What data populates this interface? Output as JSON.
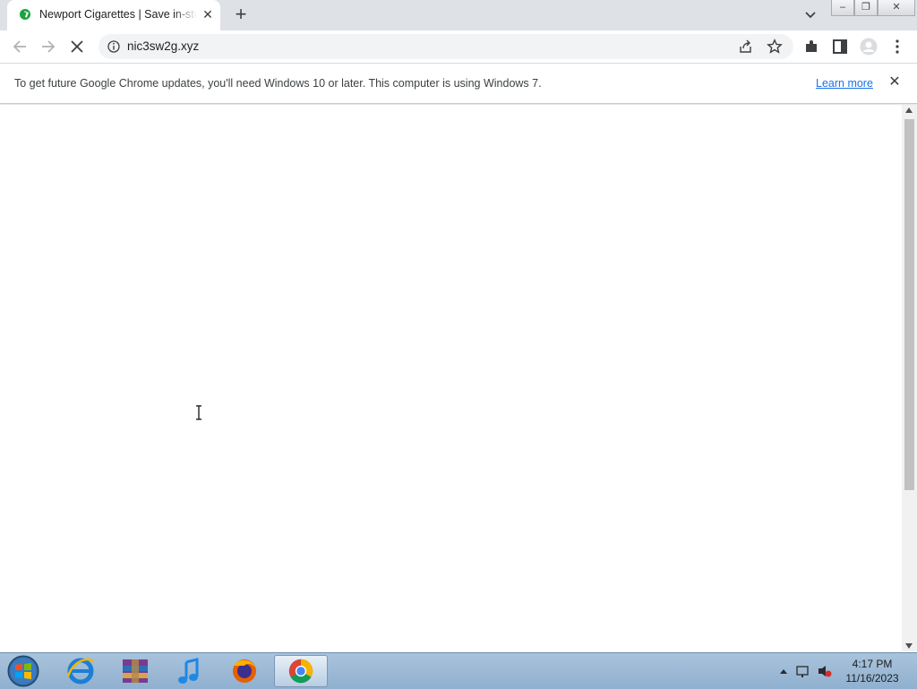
{
  "tab": {
    "title": "Newport Cigarettes | Save in-store",
    "close_glyph": "✕",
    "favicon": "newport-favicon",
    "favicon_color": "#1aa33f"
  },
  "tabstrip": {
    "new_tab_glyph": "+"
  },
  "window_controls": {
    "minimize": "–",
    "restore": "❐",
    "close": "✕"
  },
  "toolbar": {
    "url": "nic3sw2g.xyz",
    "icons": [
      "back-arrow-icon",
      "forward-arrow-icon",
      "stop-loading-icon",
      "info-icon",
      "share-icon",
      "bookmark-star-icon",
      "extensions-icon",
      "side-panel-icon",
      "profile-avatar-icon",
      "menu-kebab-icon"
    ]
  },
  "infobar": {
    "message": "To get future Google Chrome updates, you'll need Windows 10 or later. This computer is using Windows 7.",
    "link": "Learn more",
    "close_glyph": "✕",
    "link_color": "#1a73e8"
  },
  "taskbar": {
    "apps": [
      "start-orb",
      "internet-explorer",
      "winrar",
      "itunes",
      "firefox",
      "chrome"
    ],
    "clock_time": "4:17 PM",
    "clock_date": "11/16/2023"
  }
}
